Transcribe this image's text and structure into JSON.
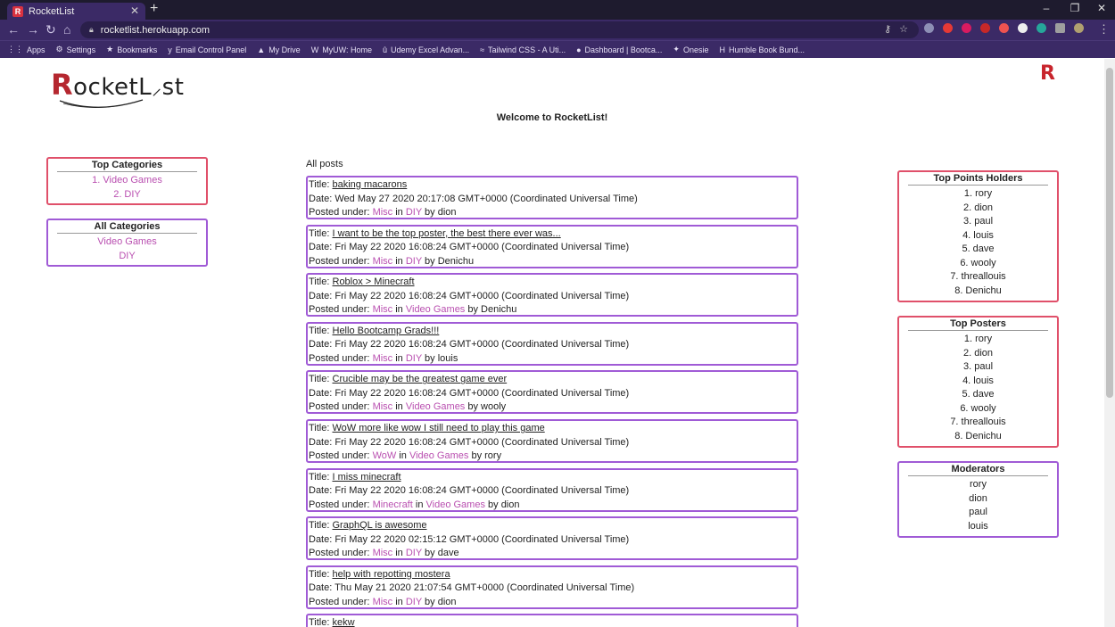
{
  "browser": {
    "tab_title": "RocketList",
    "tab_favicon": "R",
    "url": "rocketlist.herokuapp.com",
    "bookmarks": [
      {
        "icon": "apps-grid-icon",
        "glyph": "⋮⋮",
        "label": "Apps"
      },
      {
        "icon": "gear-icon",
        "glyph": "⚙",
        "label": "Settings"
      },
      {
        "icon": "star-icon",
        "glyph": "★",
        "label": "Bookmarks"
      },
      {
        "icon": "yahoo-icon",
        "glyph": "y",
        "label": "Email Control Panel"
      },
      {
        "icon": "drive-icon",
        "glyph": "▲",
        "label": "My Drive"
      },
      {
        "icon": "uw-icon",
        "glyph": "W",
        "label": "MyUW: Home"
      },
      {
        "icon": "udemy-icon",
        "glyph": "û",
        "label": "Udemy Excel Advan..."
      },
      {
        "icon": "tailwind-icon",
        "glyph": "≈",
        "label": "Tailwind CSS - A Uti..."
      },
      {
        "icon": "dashboard-icon",
        "glyph": "●",
        "label": "Dashboard | Bootca..."
      },
      {
        "icon": "onesie-icon",
        "glyph": "✦",
        "label": "Onesie"
      },
      {
        "icon": "humble-icon",
        "glyph": "H",
        "label": "Humble Book Bund..."
      }
    ]
  },
  "header": {
    "logo_text_first": "R",
    "logo_text_rest": "ocketL",
    "logo_text_end": "st",
    "corner_logo": "R",
    "welcome": "Welcome to RocketList!"
  },
  "top_categories": {
    "title": "Top Categories",
    "items": [
      "1. Video Games",
      "2. DIY"
    ]
  },
  "all_categories": {
    "title": "All Categories",
    "items": [
      "Video Games",
      "DIY"
    ]
  },
  "posts_heading": "All posts",
  "labels": {
    "title": "Title: ",
    "date": "Date: ",
    "posted_under": "Posted under: ",
    "in": " in ",
    "by": " by "
  },
  "posts": [
    {
      "title": "baking macarons",
      "date": "Wed May 27 2020 20:17:08 GMT+0000 (Coordinated Universal Time)",
      "sub": "Misc",
      "cat": "DIY",
      "author": "dion"
    },
    {
      "title": "I want to be the top poster, the best there ever was...",
      "date": "Fri May 22 2020 16:08:24 GMT+0000 (Coordinated Universal Time)",
      "sub": "Misc",
      "cat": "DIY",
      "author": "Denichu"
    },
    {
      "title": "Roblox > Minecraft",
      "date": "Fri May 22 2020 16:08:24 GMT+0000 (Coordinated Universal Time)",
      "sub": "Misc",
      "cat": "Video Games",
      "author": "Denichu"
    },
    {
      "title": "Hello Bootcamp Grads!!!",
      "date": "Fri May 22 2020 16:08:24 GMT+0000 (Coordinated Universal Time)",
      "sub": "Misc",
      "cat": "DIY",
      "author": "louis"
    },
    {
      "title": "Crucible may be the greatest game ever",
      "date": "Fri May 22 2020 16:08:24 GMT+0000 (Coordinated Universal Time)",
      "sub": "Misc",
      "cat": "Video Games",
      "author": "wooly"
    },
    {
      "title": "WoW more like wow I still need to play this game",
      "date": "Fri May 22 2020 16:08:24 GMT+0000 (Coordinated Universal Time)",
      "sub": "WoW",
      "cat": "Video Games",
      "author": "rory"
    },
    {
      "title": "I miss minecraft",
      "date": "Fri May 22 2020 16:08:24 GMT+0000 (Coordinated Universal Time)",
      "sub": "Minecraft",
      "cat": "Video Games",
      "author": "dion"
    },
    {
      "title": "GraphQL is awesome",
      "date": "Fri May 22 2020 02:15:12 GMT+0000 (Coordinated Universal Time)",
      "sub": "Misc",
      "cat": "DIY",
      "author": "dave"
    },
    {
      "title": "help with repotting mostera",
      "date": "Thu May 21 2020 21:07:54 GMT+0000 (Coordinated Universal Time)",
      "sub": "Misc",
      "cat": "DIY",
      "author": "dion"
    },
    {
      "title": "kekw",
      "date": "",
      "sub": "",
      "cat": "",
      "author": ""
    }
  ],
  "top_points": {
    "title": "Top Points Holders",
    "items": [
      "1. rory",
      "2. dion",
      "3. paul",
      "4. louis",
      "5. dave",
      "6. wooly",
      "7. threallouis",
      "8. Denichu"
    ]
  },
  "top_posters": {
    "title": "Top Posters",
    "items": [
      "1. rory",
      "2. dion",
      "3. paul",
      "4. louis",
      "5. dave",
      "6. wooly",
      "7. threallouis",
      "8. Denichu"
    ]
  },
  "moderators": {
    "title": "Moderators",
    "items": [
      "rory",
      "dion",
      "paul",
      "louis"
    ]
  },
  "colors": {
    "accent_purple": "#a05bd6",
    "accent_red": "#e0506a",
    "link_pink": "#b94fb0",
    "chrome_bg": "#3b2a66"
  }
}
